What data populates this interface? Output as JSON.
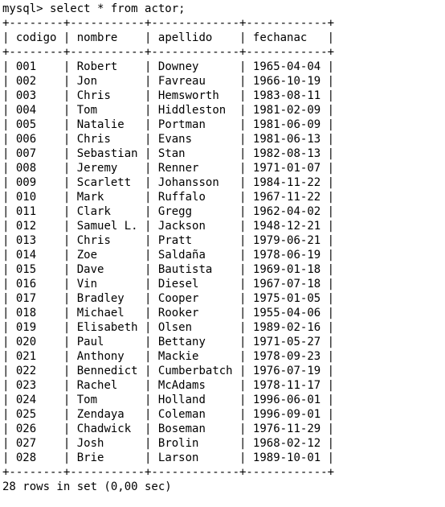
{
  "terminal": {
    "prompt": "mysql> ",
    "command": "select * from actor;",
    "columns": [
      "codigo",
      "nombre",
      "apellido",
      "fechanac"
    ],
    "rows": [
      [
        "001",
        "Robert",
        "Downey",
        "1965-04-04"
      ],
      [
        "002",
        "Jon",
        "Favreau",
        "1966-10-19"
      ],
      [
        "003",
        "Chris",
        "Hemsworth",
        "1983-08-11"
      ],
      [
        "004",
        "Tom",
        "Hiddleston",
        "1981-02-09"
      ],
      [
        "005",
        "Natalie",
        "Portman",
        "1981-06-09"
      ],
      [
        "006",
        "Chris",
        "Evans",
        "1981-06-13"
      ],
      [
        "007",
        "Sebastian",
        "Stan",
        "1982-08-13"
      ],
      [
        "008",
        "Jeremy",
        "Renner",
        "1971-01-07"
      ],
      [
        "009",
        "Scarlett",
        "Johansson",
        "1984-11-22"
      ],
      [
        "010",
        "Mark",
        "Ruffalo",
        "1967-11-22"
      ],
      [
        "011",
        "Clark",
        "Gregg",
        "1962-04-02"
      ],
      [
        "012",
        "Samuel L.",
        "Jackson",
        "1948-12-21"
      ],
      [
        "013",
        "Chris",
        "Pratt",
        "1979-06-21"
      ],
      [
        "014",
        "Zoe",
        "Saldaña",
        "1978-06-19"
      ],
      [
        "015",
        "Dave",
        "Bautista",
        "1969-01-18"
      ],
      [
        "016",
        "Vin",
        "Diesel",
        "1967-07-18"
      ],
      [
        "017",
        "Bradley",
        "Cooper",
        "1975-01-05"
      ],
      [
        "018",
        "Michael",
        "Rooker",
        "1955-04-06"
      ],
      [
        "019",
        "Elisabeth",
        "Olsen",
        "1989-02-16"
      ],
      [
        "020",
        "Paul",
        "Bettany",
        "1971-05-27"
      ],
      [
        "021",
        "Anthony",
        "Mackie",
        "1978-09-23"
      ],
      [
        "022",
        "Bennedict",
        "Cumberbatch",
        "1976-07-19"
      ],
      [
        "023",
        "Rachel",
        "McAdams",
        "1978-11-17"
      ],
      [
        "024",
        "Tom",
        "Holland",
        "1996-06-01"
      ],
      [
        "025",
        "Zendaya",
        "Coleman",
        "1996-09-01"
      ],
      [
        "026",
        "Chadwick",
        "Boseman",
        "1976-11-29"
      ],
      [
        "027",
        "Josh",
        "Brolin",
        "1968-02-12"
      ],
      [
        "028",
        "Brie",
        "Larson",
        "1989-10-01"
      ]
    ],
    "summary": "28 rows in set (0,00 sec)"
  }
}
